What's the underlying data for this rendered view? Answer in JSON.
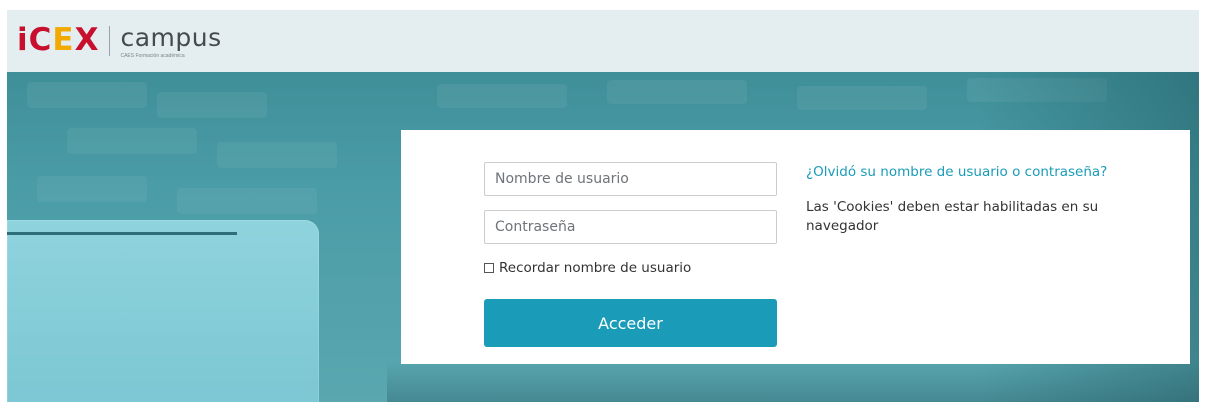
{
  "header": {
    "logo_icex_prefix": "iC",
    "logo_icex_e": "E",
    "logo_icex_suffix": "X",
    "logo_campus": "campus",
    "logo_tagline": "CAES Formación académica"
  },
  "login": {
    "username_placeholder": "Nombre de usuario",
    "password_placeholder": "Contraseña",
    "remember_label": "Recordar nombre de usuario",
    "remember_checked": false,
    "submit_label": "Acceder",
    "forgot_link": "¿Olvidó su nombre de usuario o contraseña?",
    "cookies_notice": "Las 'Cookies' deben estar habilitadas en su navegador"
  },
  "colors": {
    "brand_red": "#c8102e",
    "brand_yellow": "#f2a900",
    "accent": "#1a9cb8",
    "header_bg": "#e4eef0",
    "hero_teal": "#4a9ca6"
  },
  "icons": {
    "remember_checkbox": "checkbox-unchecked-icon"
  }
}
